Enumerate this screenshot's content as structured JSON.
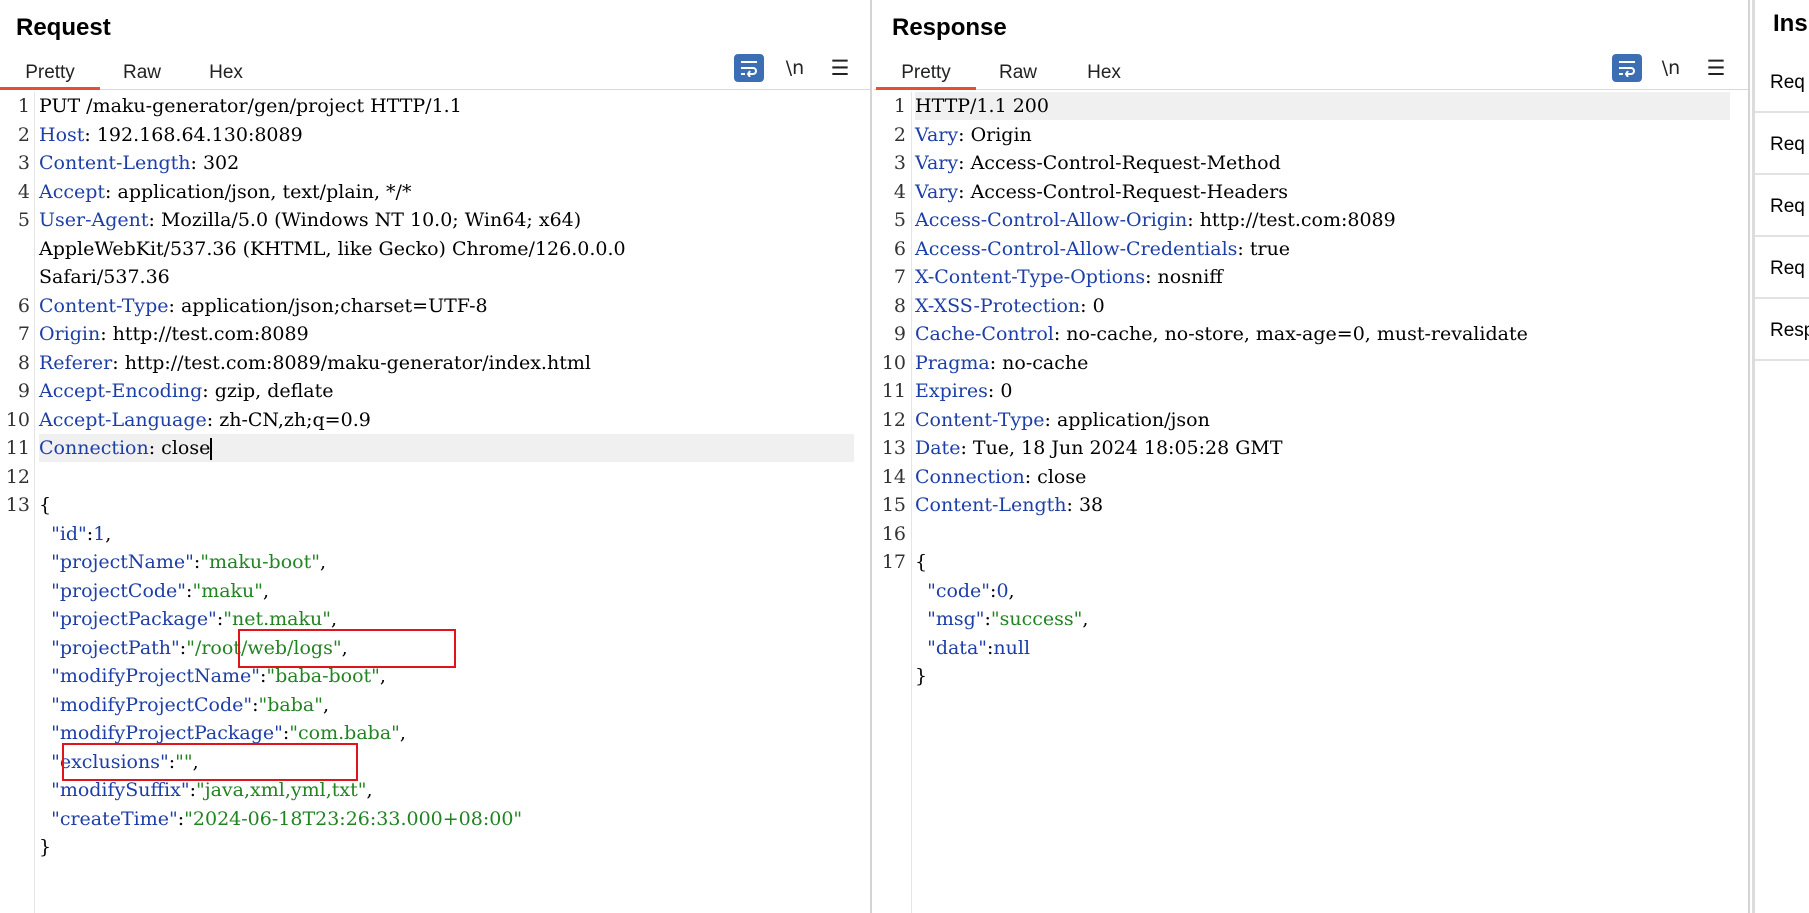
{
  "request": {
    "title": "Request",
    "tabs": [
      "Pretty",
      "Raw",
      "Hex"
    ],
    "active_tab": "Pretty",
    "newline_label": "\\n",
    "lines": [
      {
        "n": "1",
        "parts": [
          {
            "t": "PUT /maku-generator/gen/project HTTP/1.1",
            "c": ""
          }
        ]
      },
      {
        "n": "2",
        "parts": [
          {
            "t": "Host",
            "c": "k"
          },
          {
            "t": ": 192.168.64.130:8089",
            "c": ""
          }
        ]
      },
      {
        "n": "3",
        "parts": [
          {
            "t": "Content-Length",
            "c": "k"
          },
          {
            "t": ": 302",
            "c": ""
          }
        ]
      },
      {
        "n": "4",
        "parts": [
          {
            "t": "Accept",
            "c": "k"
          },
          {
            "t": ": application/json, text/plain, */*",
            "c": ""
          }
        ]
      },
      {
        "n": "5",
        "parts": [
          {
            "t": "User-Agent",
            "c": "k"
          },
          {
            "t": ": Mozilla/5.0 (Windows NT 10.0; Win64; x64)",
            "c": ""
          }
        ]
      },
      {
        "n": "",
        "parts": [
          {
            "t": "AppleWebKit/537.36 (KHTML, like Gecko) Chrome/126.0.0.0",
            "c": ""
          }
        ]
      },
      {
        "n": "",
        "parts": [
          {
            "t": "Safari/537.36",
            "c": ""
          }
        ]
      },
      {
        "n": "6",
        "parts": [
          {
            "t": "Content-Type",
            "c": "k"
          },
          {
            "t": ": application/json;charset=UTF-8",
            "c": ""
          }
        ]
      },
      {
        "n": "7",
        "parts": [
          {
            "t": "Origin",
            "c": "k"
          },
          {
            "t": ": http://test.com:8089",
            "c": ""
          }
        ]
      },
      {
        "n": "8",
        "parts": [
          {
            "t": "Referer",
            "c": "k"
          },
          {
            "t": ": http://test.com:8089/maku-generator/index.html",
            "c": ""
          }
        ]
      },
      {
        "n": "9",
        "parts": [
          {
            "t": "Accept-Encoding",
            "c": "k"
          },
          {
            "t": ": gzip, deflate",
            "c": ""
          }
        ]
      },
      {
        "n": "10",
        "parts": [
          {
            "t": "Accept-Language",
            "c": "k"
          },
          {
            "t": ": zh-CN,zh;q=0.9",
            "c": ""
          }
        ]
      },
      {
        "n": "11",
        "parts": [
          {
            "t": "Connection",
            "c": "k"
          },
          {
            "t": ": close",
            "c": ""
          }
        ],
        "cursor": true,
        "highlight": true
      },
      {
        "n": "12",
        "parts": []
      },
      {
        "n": "13",
        "parts": [
          {
            "t": "{",
            "c": ""
          }
        ]
      },
      {
        "n": "",
        "parts": [
          {
            "t": "  \"id\"",
            "c": "k"
          },
          {
            "t": ":",
            "c": ""
          },
          {
            "t": "1",
            "c": "k"
          },
          {
            "t": ",",
            "c": ""
          }
        ]
      },
      {
        "n": "",
        "parts": [
          {
            "t": "  \"projectName\"",
            "c": "k"
          },
          {
            "t": ":",
            "c": ""
          },
          {
            "t": "\"maku-boot\"",
            "c": "s"
          },
          {
            "t": ",",
            "c": ""
          }
        ]
      },
      {
        "n": "",
        "parts": [
          {
            "t": "  \"projectCode\"",
            "c": "k"
          },
          {
            "t": ":",
            "c": ""
          },
          {
            "t": "\"maku\"",
            "c": "s"
          },
          {
            "t": ",",
            "c": ""
          }
        ]
      },
      {
        "n": "",
        "parts": [
          {
            "t": "  \"projectPackage\"",
            "c": "k"
          },
          {
            "t": ":",
            "c": ""
          },
          {
            "t": "\"net.maku\"",
            "c": "s"
          },
          {
            "t": ",",
            "c": ""
          }
        ]
      },
      {
        "n": "",
        "parts": [
          {
            "t": "  \"projectPath\"",
            "c": "k"
          },
          {
            "t": ":",
            "c": ""
          },
          {
            "t": "\"/root/web/logs\"",
            "c": "s"
          },
          {
            "t": ",",
            "c": ""
          }
        ]
      },
      {
        "n": "",
        "parts": [
          {
            "t": "  \"modifyProjectName\"",
            "c": "k"
          },
          {
            "t": ":",
            "c": ""
          },
          {
            "t": "\"baba-boot\"",
            "c": "s"
          },
          {
            "t": ",",
            "c": ""
          }
        ]
      },
      {
        "n": "",
        "parts": [
          {
            "t": "  \"modifyProjectCode\"",
            "c": "k"
          },
          {
            "t": ":",
            "c": ""
          },
          {
            "t": "\"baba\"",
            "c": "s"
          },
          {
            "t": ",",
            "c": ""
          }
        ]
      },
      {
        "n": "",
        "parts": [
          {
            "t": "  \"modifyProjectPackage\"",
            "c": "k"
          },
          {
            "t": ":",
            "c": ""
          },
          {
            "t": "\"com.baba\"",
            "c": "s"
          },
          {
            "t": ",",
            "c": ""
          }
        ]
      },
      {
        "n": "",
        "parts": [
          {
            "t": "  \"exclusions\"",
            "c": "k"
          },
          {
            "t": ":",
            "c": ""
          },
          {
            "t": "\"\"",
            "c": "s"
          },
          {
            "t": ",",
            "c": ""
          }
        ]
      },
      {
        "n": "",
        "parts": [
          {
            "t": "  \"modifySuffix\"",
            "c": "k"
          },
          {
            "t": ":",
            "c": ""
          },
          {
            "t": "\"java,xml,yml,txt\"",
            "c": "s"
          },
          {
            "t": ",",
            "c": ""
          }
        ]
      },
      {
        "n": "",
        "parts": [
          {
            "t": "  \"createTime\"",
            "c": "k"
          },
          {
            "t": ":",
            "c": ""
          },
          {
            "t": "\"2024-06-18T23:26:33.000+08:00\"",
            "c": "s"
          }
        ]
      },
      {
        "n": "",
        "parts": [
          {
            "t": "}",
            "c": ""
          }
        ]
      }
    ]
  },
  "response": {
    "title": "Response",
    "tabs": [
      "Pretty",
      "Raw",
      "Hex"
    ],
    "active_tab": "Pretty",
    "newline_label": "\\n",
    "lines": [
      {
        "n": "1",
        "parts": [
          {
            "t": "HTTP/1.1 200",
            "c": ""
          }
        ],
        "highlight": true
      },
      {
        "n": "2",
        "parts": [
          {
            "t": "Vary",
            "c": "k"
          },
          {
            "t": ": Origin",
            "c": ""
          }
        ]
      },
      {
        "n": "3",
        "parts": [
          {
            "t": "Vary",
            "c": "k"
          },
          {
            "t": ": Access-Control-Request-Method",
            "c": ""
          }
        ]
      },
      {
        "n": "4",
        "parts": [
          {
            "t": "Vary",
            "c": "k"
          },
          {
            "t": ": Access-Control-Request-Headers",
            "c": ""
          }
        ]
      },
      {
        "n": "5",
        "parts": [
          {
            "t": "Access-Control-Allow-Origin",
            "c": "k"
          },
          {
            "t": ": http://test.com:8089",
            "c": ""
          }
        ]
      },
      {
        "n": "6",
        "parts": [
          {
            "t": "Access-Control-Allow-Credentials",
            "c": "k"
          },
          {
            "t": ": true",
            "c": ""
          }
        ]
      },
      {
        "n": "7",
        "parts": [
          {
            "t": "X-Content-Type-Options",
            "c": "k"
          },
          {
            "t": ": nosniff",
            "c": ""
          }
        ]
      },
      {
        "n": "8",
        "parts": [
          {
            "t": "X-XSS-Protection",
            "c": "k"
          },
          {
            "t": ": 0",
            "c": ""
          }
        ]
      },
      {
        "n": "9",
        "parts": [
          {
            "t": "Cache-Control",
            "c": "k"
          },
          {
            "t": ": no-cache, no-store, max-age=0, must-revalidate",
            "c": ""
          }
        ]
      },
      {
        "n": "10",
        "parts": [
          {
            "t": "Pragma",
            "c": "k"
          },
          {
            "t": ": no-cache",
            "c": ""
          }
        ]
      },
      {
        "n": "11",
        "parts": [
          {
            "t": "Expires",
            "c": "k"
          },
          {
            "t": ": 0",
            "c": ""
          }
        ]
      },
      {
        "n": "12",
        "parts": [
          {
            "t": "Content-Type",
            "c": "k"
          },
          {
            "t": ": application/json",
            "c": ""
          }
        ]
      },
      {
        "n": "13",
        "parts": [
          {
            "t": "Date",
            "c": "k"
          },
          {
            "t": ": Tue, 18 Jun 2024 18:05:28 GMT",
            "c": ""
          }
        ]
      },
      {
        "n": "14",
        "parts": [
          {
            "t": "Connection",
            "c": "k"
          },
          {
            "t": ": close",
            "c": ""
          }
        ]
      },
      {
        "n": "15",
        "parts": [
          {
            "t": "Content-Length",
            "c": "k"
          },
          {
            "t": ": 38",
            "c": ""
          }
        ]
      },
      {
        "n": "16",
        "parts": []
      },
      {
        "n": "17",
        "parts": [
          {
            "t": "{",
            "c": ""
          }
        ]
      },
      {
        "n": "",
        "parts": [
          {
            "t": "  \"code\"",
            "c": "k"
          },
          {
            "t": ":",
            "c": ""
          },
          {
            "t": "0",
            "c": "k"
          },
          {
            "t": ",",
            "c": ""
          }
        ]
      },
      {
        "n": "",
        "parts": [
          {
            "t": "  \"msg\"",
            "c": "k"
          },
          {
            "t": ":",
            "c": ""
          },
          {
            "t": "\"success\"",
            "c": "s"
          },
          {
            "t": ",",
            "c": ""
          }
        ]
      },
      {
        "n": "",
        "parts": [
          {
            "t": "  \"data\"",
            "c": "k"
          },
          {
            "t": ":",
            "c": ""
          },
          {
            "t": "null",
            "c": "k"
          }
        ]
      },
      {
        "n": "",
        "parts": [
          {
            "t": "}",
            "c": ""
          }
        ]
      }
    ]
  },
  "inspector": {
    "title": "Insp",
    "items": [
      "Req",
      "Req",
      "Req",
      "Req",
      "Resp"
    ]
  },
  "colors": {
    "header_key": "#1d3ea6",
    "string_value": "#228322",
    "active_tab_underline": "#e5502e",
    "annotation_box": "#e0141b",
    "button_blue": "#2f64a8"
  }
}
